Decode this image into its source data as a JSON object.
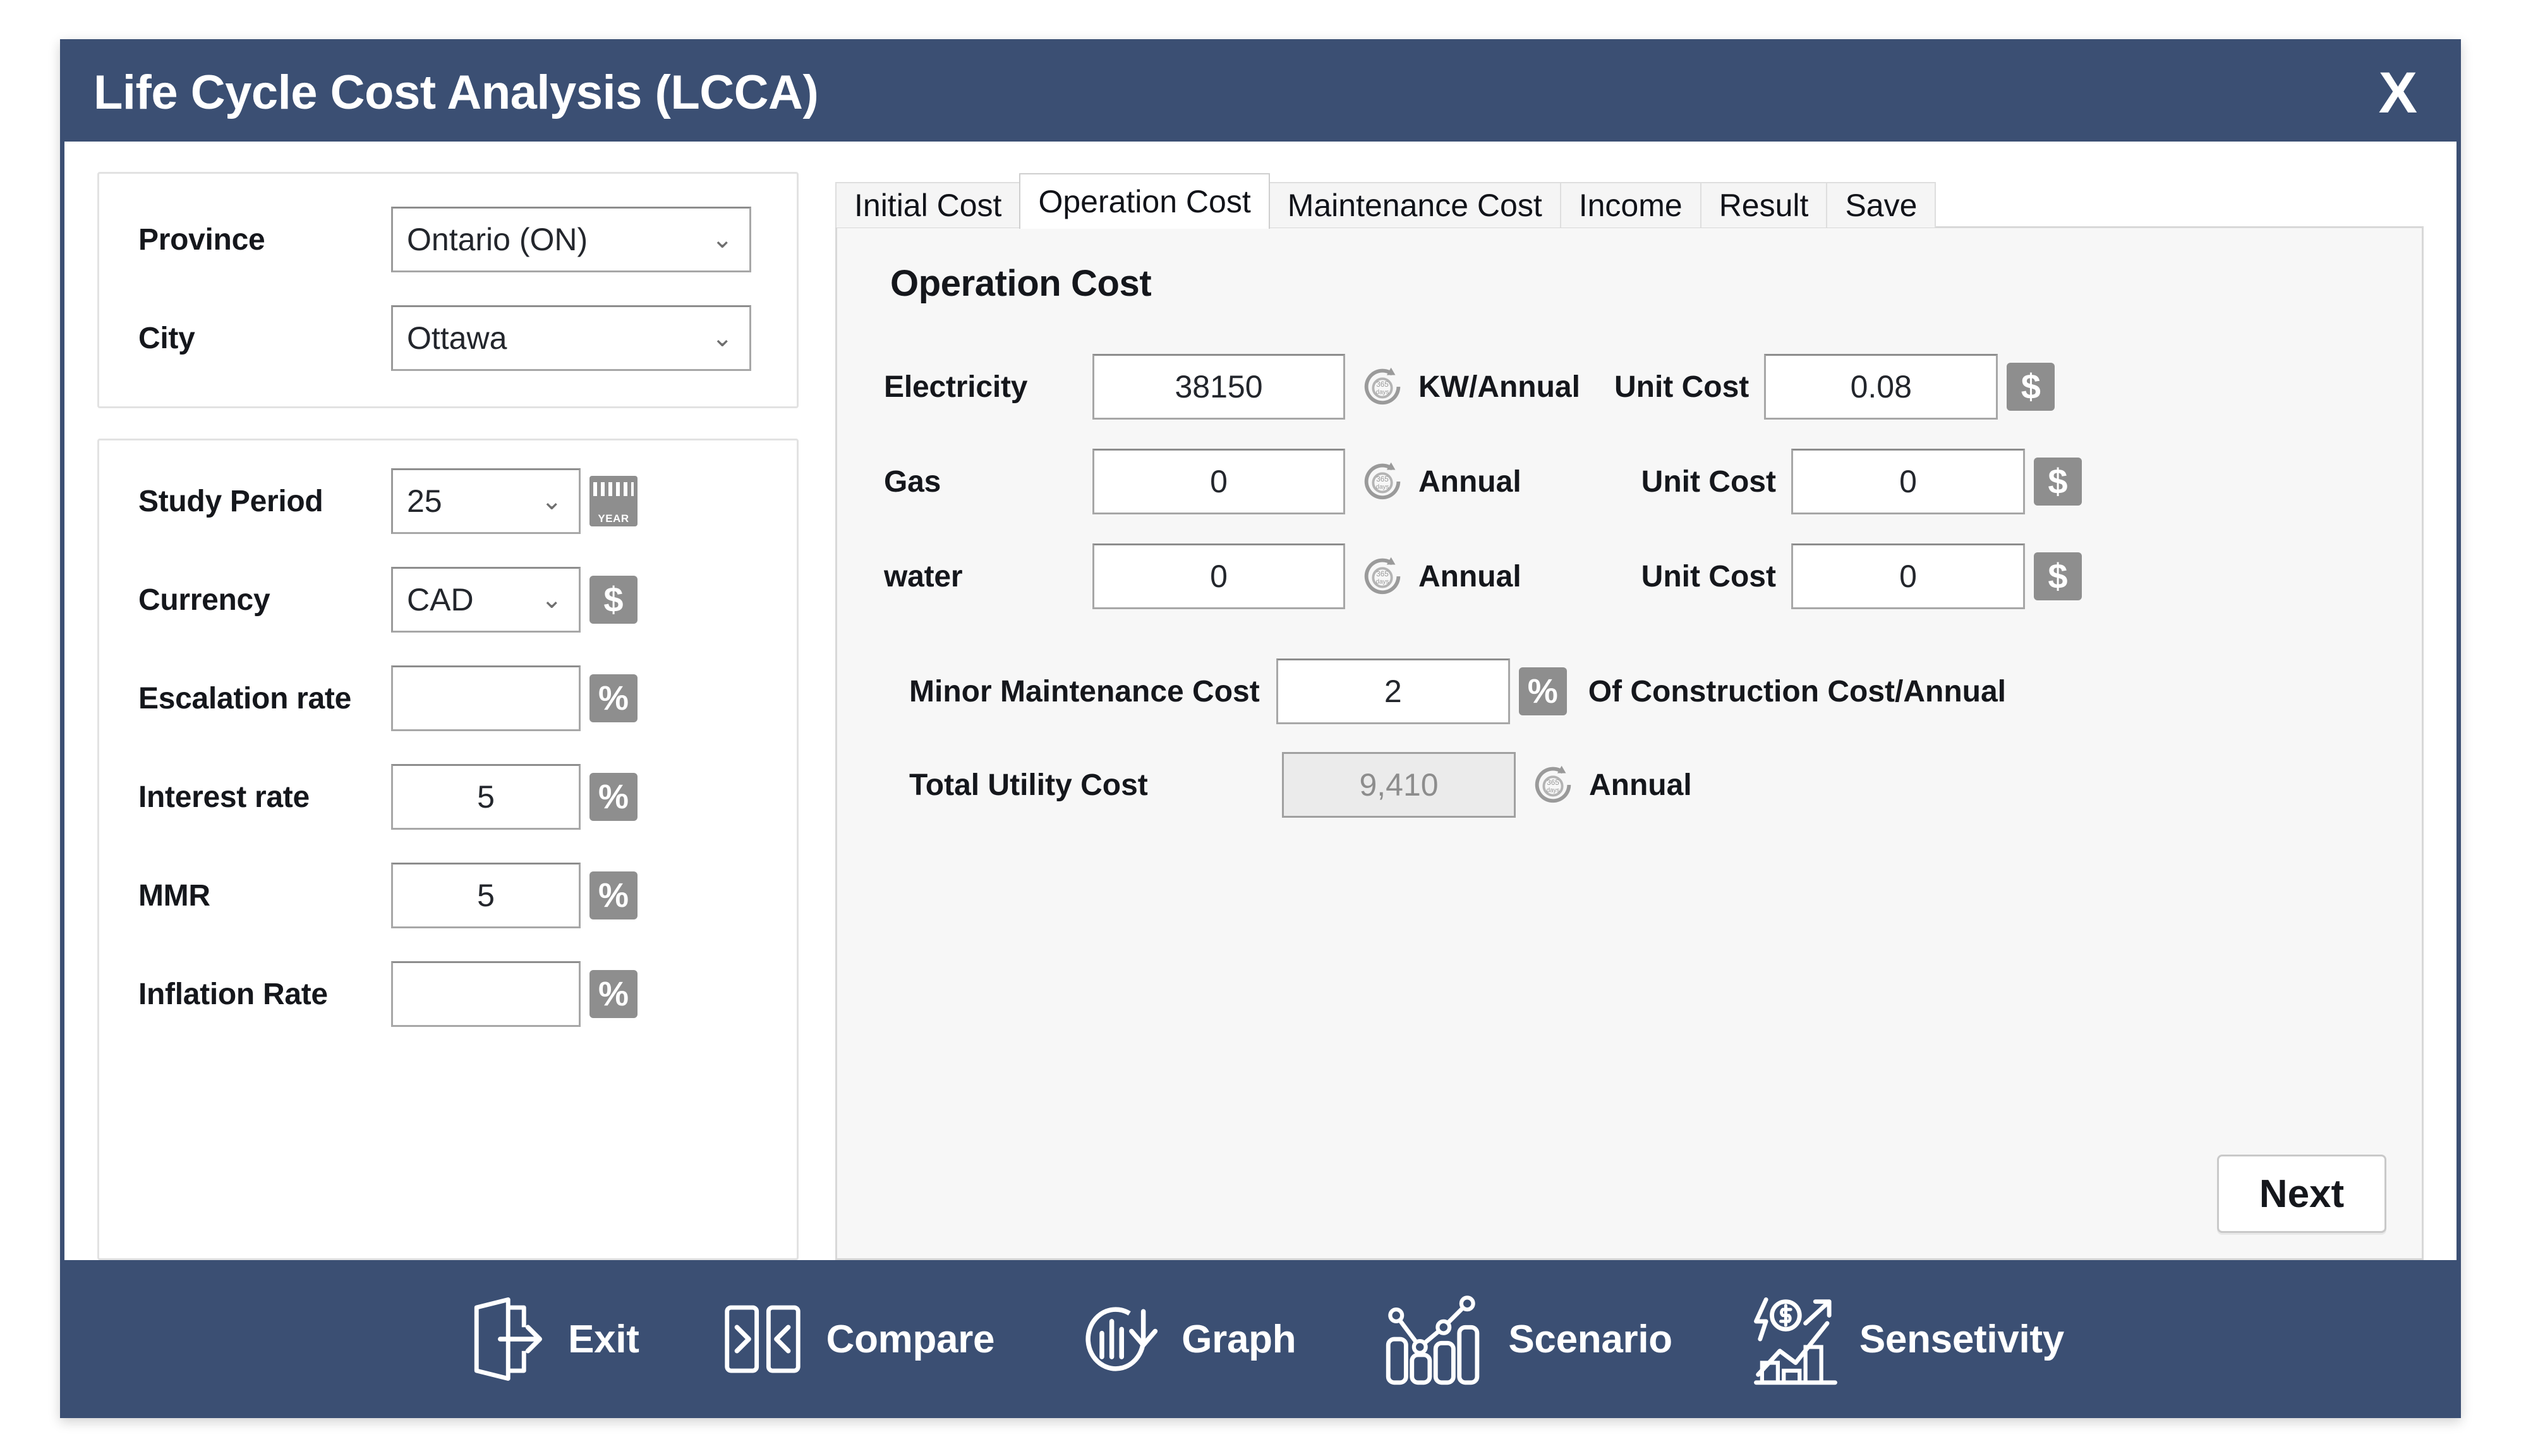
{
  "window": {
    "title": "Life Cycle Cost Analysis (LCCA)",
    "close_label": "X",
    "accent_color": "#3b4f73"
  },
  "location": {
    "province_label": "Province",
    "province_value": "Ontario (ON)",
    "city_label": "City",
    "city_value": "Ottawa"
  },
  "params": {
    "study_period_label": "Study Period",
    "study_period_value": "25",
    "study_period_badge": "YEAR",
    "currency_label": "Currency",
    "currency_value": "CAD",
    "currency_badge": "$",
    "escalation_label": "Escalation rate",
    "escalation_value": "",
    "escalation_badge": "%",
    "interest_label": "Interest rate",
    "interest_value": "5",
    "interest_badge": "%",
    "mmr_label": "MMR",
    "mmr_value": "5",
    "mmr_badge": "%",
    "inflation_label": "Inflation Rate",
    "inflation_value": "",
    "inflation_badge": "%"
  },
  "tabs": [
    {
      "label": "Initial Cost",
      "active": false
    },
    {
      "label": "Operation Cost",
      "active": true
    },
    {
      "label": "Maintenance Cost",
      "active": false
    },
    {
      "label": "Income",
      "active": false
    },
    {
      "label": "Result",
      "active": false
    },
    {
      "label": "Save",
      "active": false
    }
  ],
  "panel": {
    "heading": "Operation Cost",
    "rows": [
      {
        "label": "Electricity",
        "value": "38150",
        "unit": "KW/Annual",
        "unit_cost_label": "Unit Cost",
        "unit_cost_value": "0.08",
        "unit_cost_badge": "$"
      },
      {
        "label": "Gas",
        "value": "0",
        "unit": "Annual",
        "unit_cost_label": "Unit Cost",
        "unit_cost_value": "0",
        "unit_cost_badge": "$"
      },
      {
        "label": "water",
        "value": "0",
        "unit": "Annual",
        "unit_cost_label": "Unit Cost",
        "unit_cost_value": "0",
        "unit_cost_badge": "$"
      }
    ],
    "minor_maintenance_label": "Minor Maintenance Cost",
    "minor_maintenance_value": "2",
    "minor_maintenance_badge": "%",
    "minor_maintenance_suffix": "Of Construction Cost/Annual",
    "total_utility_label": "Total Utility Cost",
    "total_utility_value": "9,410",
    "total_utility_unit": "Annual",
    "next_label": "Next"
  },
  "footer": {
    "items": [
      {
        "label": "Exit",
        "icon": "exit-door-icon"
      },
      {
        "label": "Compare",
        "icon": "compare-panels-icon"
      },
      {
        "label": "Graph",
        "icon": "graph-refresh-icon"
      },
      {
        "label": "Scenario",
        "icon": "scenario-bars-line-icon"
      },
      {
        "label": "Sensetivity",
        "icon": "sensitivity-trend-icon"
      }
    ]
  }
}
